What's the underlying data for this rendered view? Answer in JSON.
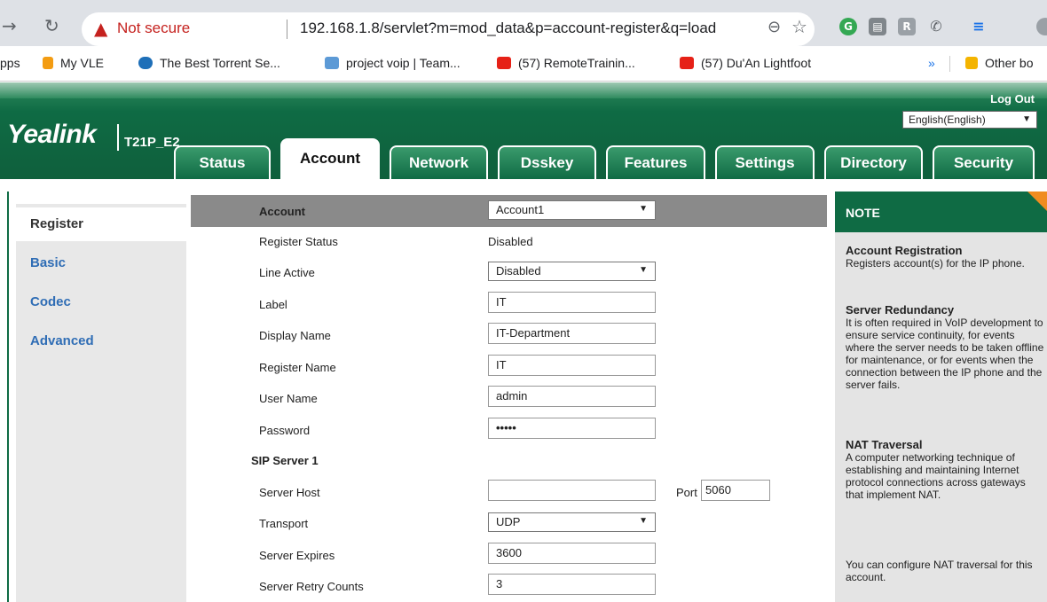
{
  "browser": {
    "not_secure": "Not secure",
    "url": "192.168.1.8/servlet?m=mod_data&p=account-register&q=load",
    "bookmarks": [
      {
        "label": "pps",
        "color": "transparent"
      },
      {
        "label": "My VLE",
        "color": "#f39c12"
      },
      {
        "label": "The Best Torrent Se...",
        "color": "#1e6fb8"
      },
      {
        "label": "project voip | Team...",
        "color": "#5c9ad6"
      },
      {
        "label": "(57) RemoteTrainin...",
        "color": "#e62117"
      },
      {
        "label": "(57) Du'An Lightfoot",
        "color": "#e62117"
      }
    ],
    "more": "»",
    "other_bookmarks": "Other bo"
  },
  "header": {
    "logo": "Yealink",
    "model": "T21P_E2",
    "logout": "Log Out",
    "language": "English(English)"
  },
  "tabs": [
    "Status",
    "Account",
    "Network",
    "Dsskey",
    "Features",
    "Settings",
    "Directory",
    "Security"
  ],
  "active_tab": "Account",
  "sidenav": [
    "Register",
    "Basic",
    "Codec",
    "Advanced"
  ],
  "form": {
    "account_label": "Account",
    "account_value": "Account1",
    "register_status_label": "Register Status",
    "register_status_value": "Disabled",
    "line_active_label": "Line Active",
    "line_active_value": "Disabled",
    "label_label": "Label",
    "label_value": "IT",
    "display_name_label": "Display Name",
    "display_name_value": "IT-Department",
    "register_name_label": "Register Name",
    "register_name_value": "IT",
    "user_name_label": "User Name",
    "user_name_value": "admin",
    "password_label": "Password",
    "password_value": "•••••",
    "sip_server_label": "SIP Server 1",
    "server_host_label": "Server Host",
    "server_host_value": "",
    "port_label": "Port",
    "port_value": "5060",
    "transport_label": "Transport",
    "transport_value": "UDP",
    "server_expires_label": "Server Expires",
    "server_expires_value": "3600",
    "server_retry_label": "Server Retry Counts",
    "server_retry_value": "3"
  },
  "note": {
    "title": "NOTE",
    "s1_title": "Account Registration",
    "s1_body": "Registers account(s) for the IP phone.",
    "s2_title": "Server Redundancy",
    "s2_body": "It is often required in VoIP development to ensure service continuity, for events where the server needs to be taken offline for maintenance, or for events when the connection between the IP phone and the server fails.",
    "s3_title": "NAT Traversal",
    "s3_body": "A computer networking technique of establishing and maintaining Internet protocol connections across gateways that implement NAT.",
    "s4_body": "You can configure NAT traversal for this account."
  }
}
